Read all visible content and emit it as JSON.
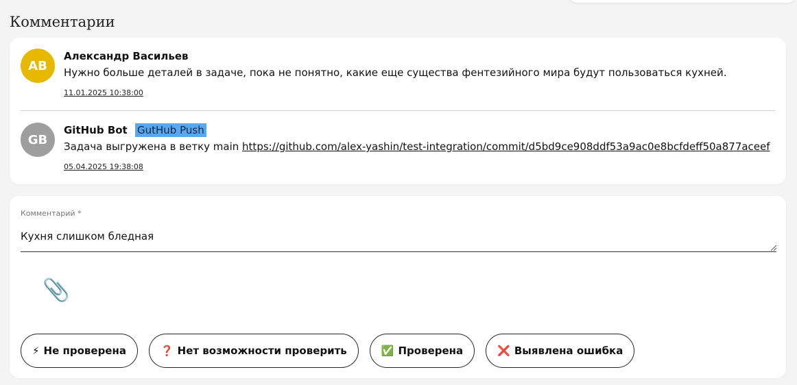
{
  "section_title": "Комментарии",
  "comments": [
    {
      "avatar_initials": "AB",
      "avatar_color": "#e6b800",
      "author": "Александр Васильев",
      "text": "Нужно больше деталей в задаче, пока не понятно, какие еще существа фентезийного мира будут пользоваться кухней.",
      "date": "11.01.2025 10:38:00"
    },
    {
      "avatar_initials": "GB",
      "avatar_color": "#9e9e9e",
      "author": "GitHub Bot",
      "tag": "GutHub Push",
      "text": "Задача выгружена в ветку main",
      "link": "https://github.com/alex-yashin/test-integration/commit/d5bd9ce908ddf53a9ac0e8bcfdeff50a877aceef",
      "date": "05.04.2025 19:38:08"
    }
  ],
  "form": {
    "label": "Комментарий *",
    "value": "Кухня слишком бледная",
    "attach_icon": "paperclip-icon"
  },
  "status_buttons": [
    {
      "icon": "⚡",
      "label": "Не проверена"
    },
    {
      "icon": "❓",
      "label": "Нет возможности проверить"
    },
    {
      "icon": "✅",
      "label": "Проверена"
    },
    {
      "icon": "❌",
      "label": "Выявлена ошибка"
    }
  ]
}
